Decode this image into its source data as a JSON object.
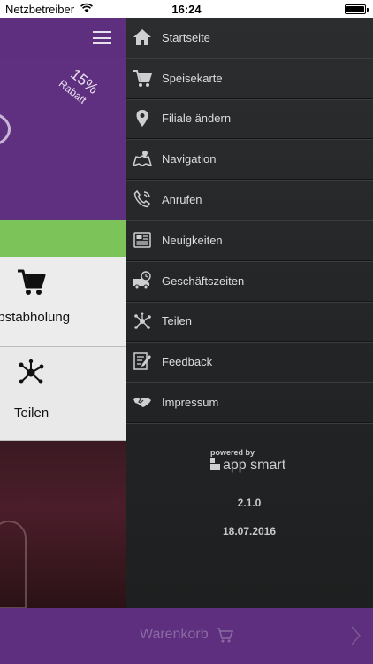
{
  "status_bar": {
    "carrier": "Netzbetreiber",
    "time": "16:24",
    "battery_percent": 100
  },
  "background_app": {
    "discount": {
      "percent": "15%",
      "label": "Rabatt"
    },
    "tiles": [
      {
        "label": "lbstabholung",
        "icon": "shopping-cart-icon"
      },
      {
        "label": "Teilen",
        "icon": "share-icon"
      }
    ],
    "colors": {
      "header": "#5d2f7e",
      "green_bar": "#7cc35a"
    }
  },
  "drawer": {
    "items": [
      {
        "label": "Startseite",
        "icon": "home-icon"
      },
      {
        "label": "Speisekarte",
        "icon": "shopping-cart-icon"
      },
      {
        "label": "Filiale ändern",
        "icon": "location-pin-icon"
      },
      {
        "label": "Navigation",
        "icon": "map-icon"
      },
      {
        "label": "Anrufen",
        "icon": "phone-icon"
      },
      {
        "label": "Neuigkeiten",
        "icon": "newspaper-icon"
      },
      {
        "label": "Geschäftszeiten",
        "icon": "delivery-clock-icon"
      },
      {
        "label": "Teilen",
        "icon": "share-icon"
      },
      {
        "label": "Feedback",
        "icon": "feedback-form-icon"
      },
      {
        "label": "Impressum",
        "icon": "handshake-icon"
      }
    ],
    "powered_by": "powered by",
    "brand": "app smart",
    "version": "2.1.0",
    "date": "18.07.2016"
  },
  "footer": {
    "cart_label": "Warenkorb"
  }
}
